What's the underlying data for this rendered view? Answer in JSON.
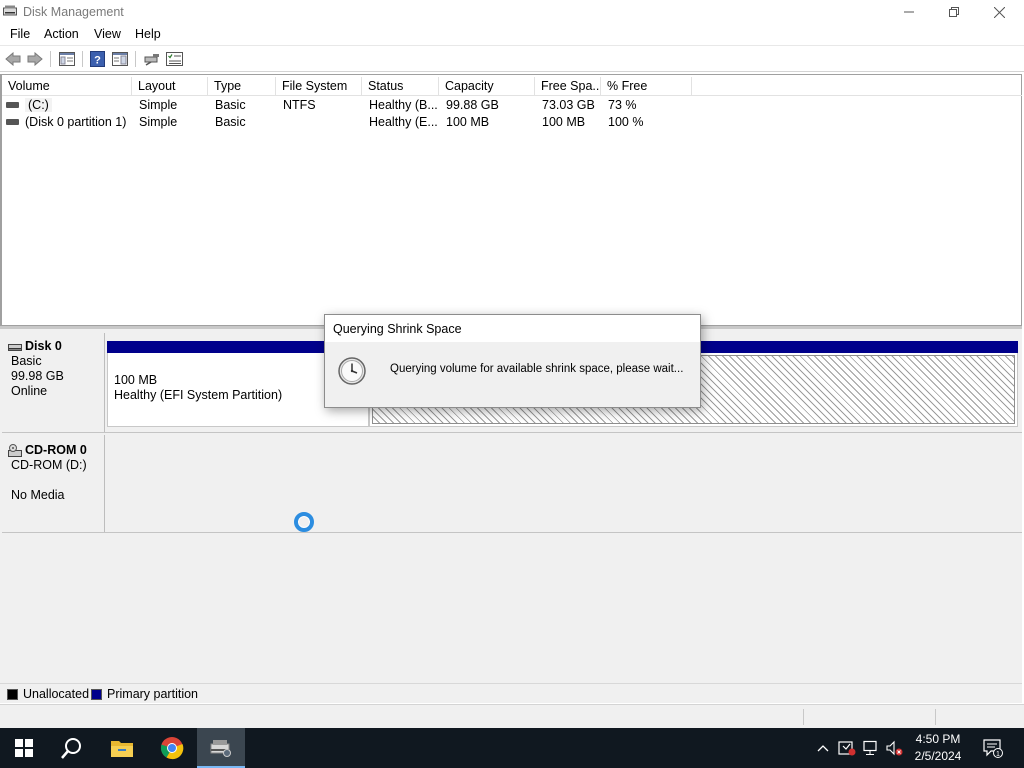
{
  "window": {
    "title": "Disk Management",
    "controls": [
      "minimize",
      "restore",
      "close"
    ]
  },
  "menu": [
    "File",
    "Action",
    "View",
    "Help"
  ],
  "toolbar": {
    "icons": [
      "back-icon",
      "forward-icon",
      "properties-icon",
      "help-icon",
      "refresh-icon",
      "connect-icon",
      "properties-list-icon"
    ]
  },
  "volume_table": {
    "columns": [
      "Volume",
      "Layout",
      "Type",
      "File System",
      "Status",
      "Capacity",
      "Free Spa...",
      "% Free"
    ],
    "rows": [
      [
        "(C:)",
        "Simple",
        "Basic",
        "NTFS",
        "Healthy (B...",
        "99.88 GB",
        "73.03 GB",
        "73 %"
      ],
      [
        "(Disk 0 partition 1)",
        "Simple",
        "Basic",
        "",
        "Healthy (E...",
        "100 MB",
        "100 MB",
        "100 %"
      ]
    ]
  },
  "disks": {
    "disk0": {
      "name": "Disk 0",
      "type": "Basic",
      "size": "99.98 GB",
      "state": "Online",
      "partition1": {
        "size": "100 MB",
        "status": "Healthy (EFI System Partition)"
      }
    },
    "cdrom0": {
      "name": "CD-ROM 0",
      "drive": "CD-ROM (D:)",
      "media": "No Media"
    }
  },
  "legend": {
    "unallocated": {
      "label": "Unallocated",
      "color": "#000000"
    },
    "primary": {
      "label": "Primary partition",
      "color": "#00008b"
    }
  },
  "dialog": {
    "title": "Querying Shrink Space",
    "message": "Querying volume for available shrink space, please wait..."
  },
  "taskbar": {
    "apps": [
      "windows-start-icon",
      "search-icon",
      "file-explorer-icon",
      "chrome-icon",
      "disk-management-icon"
    ],
    "clock_time": "4:50 PM",
    "clock_date": "2/5/2024",
    "notification_count": "1"
  },
  "colors": {
    "primary_partition": "#00008b",
    "taskbar": "#101820",
    "accent": "#2c8de0"
  }
}
